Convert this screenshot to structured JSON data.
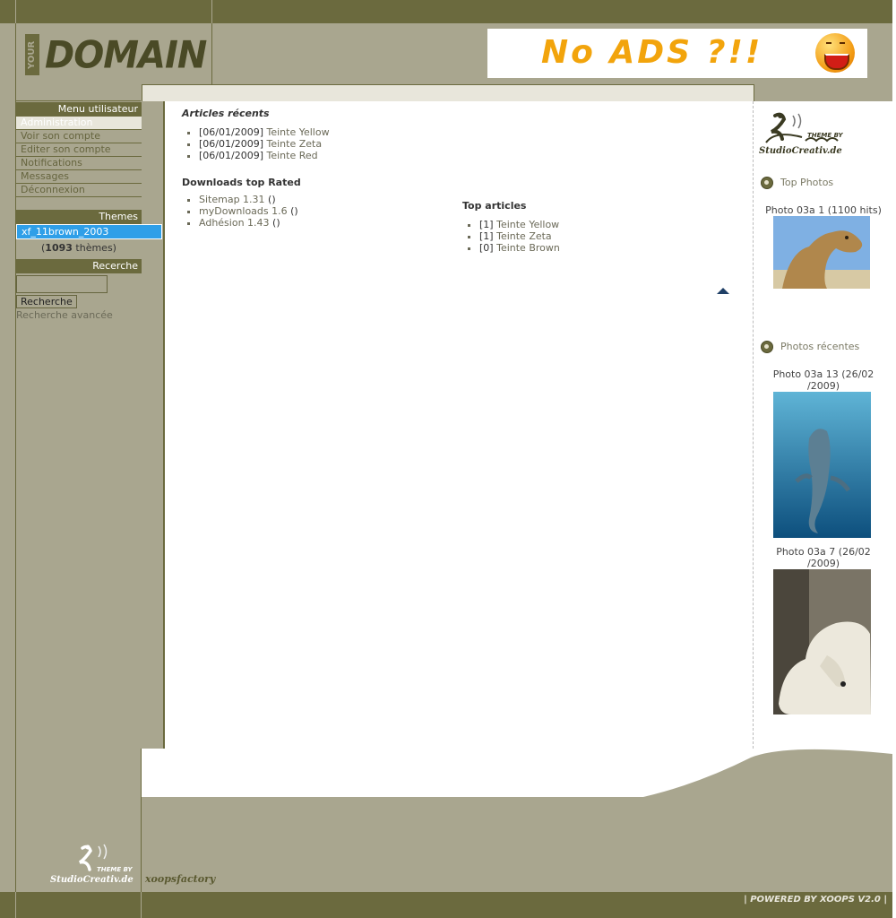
{
  "header": {
    "logo_your": "YOUR",
    "logo_domain": "DOMAIN",
    "banner_text": "No ADS ?!!"
  },
  "left": {
    "user_menu": {
      "title": "Menu utilisateur",
      "items": [
        "Administration",
        "Voir son compte",
        "Editer son compte",
        "Notifications",
        "Messages",
        "Déconnexion"
      ]
    },
    "themes": {
      "title": "Themes",
      "selected": "xf_11brown_2003",
      "count_open": "(",
      "count": "1093",
      "count_suffix": " thèmes)"
    },
    "search": {
      "title": "Recerche",
      "button": "Recherche",
      "advanced": "Recherche avancée"
    }
  },
  "main": {
    "recent_title": "Articles récents",
    "recent": [
      {
        "date": "[06/01/2009]",
        "title": "Teinte Yellow"
      },
      {
        "date": "[06/01/2009]",
        "title": "Teinte Zeta"
      },
      {
        "date": "[06/01/2009]",
        "title": "Teinte Red"
      }
    ],
    "downloads_title": "Downloads top Rated",
    "downloads": [
      {
        "name": "Sitemap 1.31",
        "extra": " ()"
      },
      {
        "name": "myDownloads 1.6",
        "extra": " ()"
      },
      {
        "name": "Adhésion 1.43",
        "extra": " ()"
      }
    ],
    "top_title": "Top articles",
    "top": [
      {
        "count": "[1]",
        "title": "Teinte Yellow"
      },
      {
        "count": "[1]",
        "title": "Teinte Zeta"
      },
      {
        "count": "[0]",
        "title": "Teinte Brown"
      }
    ]
  },
  "right": {
    "theme_by": "THEME BY",
    "studio": "StudioCreativ.de",
    "top_photos_title": "Top Photos",
    "top_photo_caption": "Photo 03a 1 (1100 hits)",
    "recent_photos_title": "Photos récentes",
    "recent_photo1_caption_1": "Photo 03a 13 (26/02",
    "recent_photo1_caption_2": "/2009)",
    "recent_photo2_caption_1": "Photo 03a 7 (26/02",
    "recent_photo2_caption_2": "/2009)"
  },
  "footer": {
    "theme_by": "THEME BY",
    "studio": "StudioCreativ.de",
    "factory": "xoopsfactory",
    "powered": "| POWERED BY XOOPS V2.0 |"
  },
  "colors": {
    "olive_dark": "#6b6a3e",
    "olive_light": "#a9a68f",
    "cream": "#e8e6db",
    "select_blue": "#2f9fe8"
  }
}
